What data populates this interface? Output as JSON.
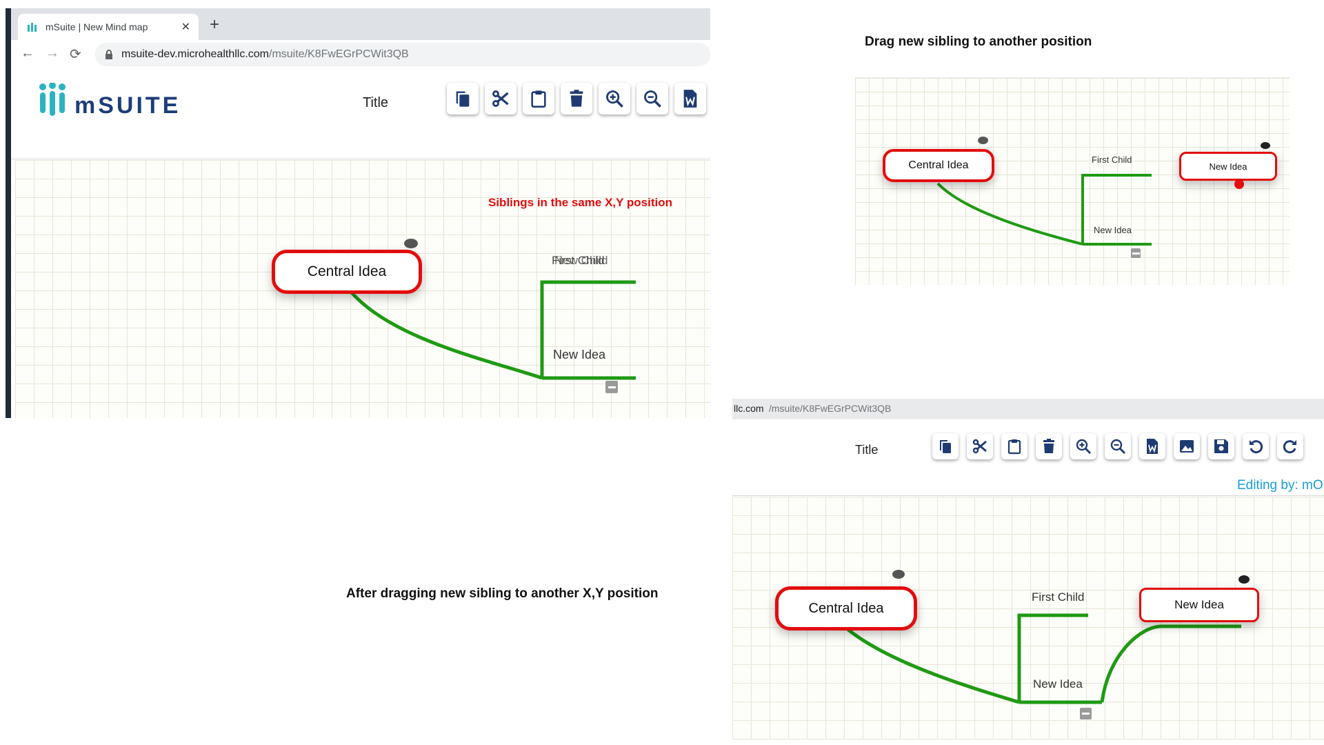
{
  "panel_a": {
    "tab_title": "mSuite | New Mind map",
    "tab_close": "✕",
    "new_tab": "+",
    "url_host": "msuite-dev.microhealthllc.com",
    "url_path": "/msuite/K8FwEGrPCWit3QB",
    "logo_text": "mSUITE",
    "title": "Title",
    "annotation": "Siblings in the same X,Y position",
    "central_idea": "Central Idea",
    "overlap_label_a": "First Child",
    "overlap_label_b": "New Child",
    "new_idea": "New Idea",
    "toolbar": [
      "copy",
      "cut",
      "paste",
      "delete",
      "zoom-in",
      "zoom-out",
      "export-word"
    ]
  },
  "panel_b": {
    "heading": "Drag new sibling to another position",
    "central_idea": "Central Idea",
    "first_child": "First Child",
    "new_idea": "New Idea",
    "dragged_node": "New Idea"
  },
  "panel_c": {
    "caption": "After dragging new sibling to another X,Y position",
    "url_host": "llc.com",
    "url_path": "/msuite/K8FwEGrPCWit3QB",
    "title": "Title",
    "editing": "Editing by: mO",
    "central_idea": "Central Idea",
    "first_child": "First Child",
    "new_idea": "New Idea",
    "moved_node": "New Idea",
    "toolbar": [
      "copy",
      "cut",
      "paste",
      "delete",
      "zoom-in",
      "zoom-out",
      "export-word",
      "export-image",
      "save",
      "undo",
      "redo"
    ]
  },
  "colors": {
    "node_border": "#e20d0d",
    "branch": "#1f9a14",
    "annotation": "#e20d0d",
    "logo": "#1d3d7a",
    "logo_mark": "#2bb3c0",
    "editing": "#1a9bd7"
  }
}
